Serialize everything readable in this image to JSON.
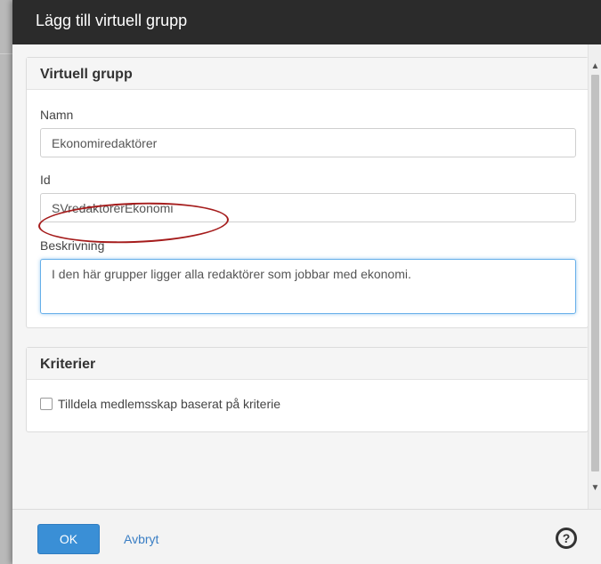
{
  "dialog": {
    "title": "Lägg till virtuell grupp"
  },
  "panel_group": {
    "heading": "Virtuell grupp",
    "name_label": "Namn",
    "name_value": "Ekonomiredaktörer",
    "id_label": "Id",
    "id_value": "SVredaktorerEkonomi",
    "description_label": "Beskrivning",
    "description_value": "I den här grupper ligger alla redaktörer som jobbar med ekonomi."
  },
  "panel_criteria": {
    "heading": "Kriterier",
    "checkbox_label": "Tilldela medlemsskap baserat på kriterie",
    "checked": false
  },
  "footer": {
    "ok_label": "OK",
    "cancel_label": "Avbryt",
    "help_glyph": "?"
  },
  "icons": {
    "help": "help-circle-icon",
    "scroll_up": "chevron-up-icon",
    "scroll_down": "chevron-down-icon"
  },
  "colors": {
    "titlebar": "#2b2b2b",
    "primary": "#3a8fd6",
    "link": "#3a7ec4",
    "annotation": "#a51c1c"
  }
}
